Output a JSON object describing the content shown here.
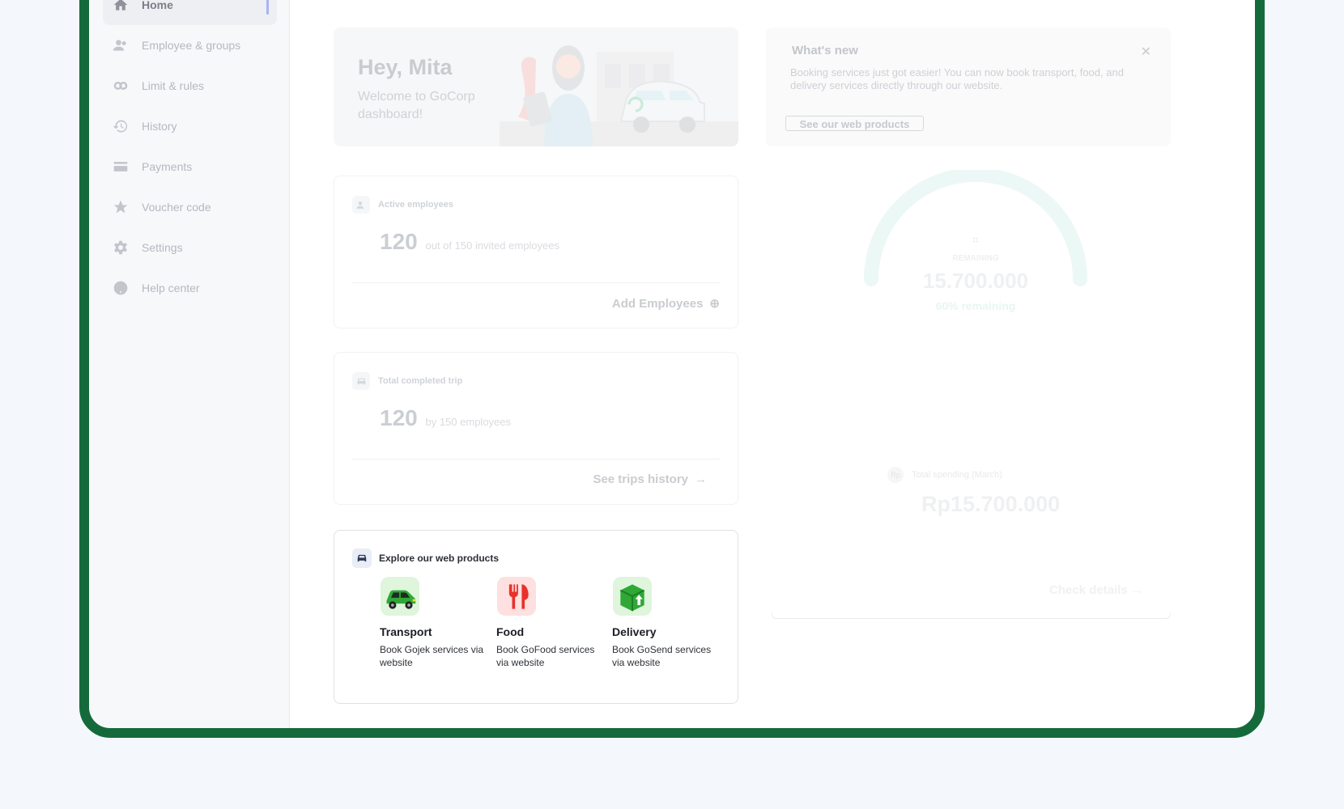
{
  "sidebar": {
    "items": [
      {
        "label": "Home",
        "icon": "home-icon",
        "active": true
      },
      {
        "label": "Employee & groups",
        "icon": "people-icon"
      },
      {
        "label": "Limit & rules",
        "icon": "limit-icon"
      },
      {
        "label": "History",
        "icon": "history-icon"
      },
      {
        "label": "Payments",
        "icon": "card-icon"
      },
      {
        "label": "Voucher code",
        "icon": "star-icon"
      },
      {
        "label": "Settings",
        "icon": "gear-icon"
      },
      {
        "label": "Help center",
        "icon": "help-icon"
      }
    ]
  },
  "greeting": {
    "title": "Hey, Mita",
    "subtitle": "Welcome to GoCorp dashboard!"
  },
  "whats_new": {
    "title": "What's new",
    "description": "Booking services just got easier! You can now book transport, food, and delivery services directly through our website.",
    "button": "See our web products"
  },
  "active_employees": {
    "label": "Active employees",
    "count": "120",
    "detail": "out of 150 invited employees",
    "action": "Add Employees"
  },
  "completed_trips": {
    "label": "Total completed trip",
    "count": "120",
    "detail": "by 150 employees",
    "action": "See trips history"
  },
  "budget": {
    "caption": "REMAINING",
    "amount": "15.700.000",
    "percent": "60% remaining",
    "remaining_fraction": 0.6
  },
  "spending": {
    "badge": "Rp",
    "label": "Total spending (March)",
    "amount": "Rp15.700.000",
    "action": "Check details"
  },
  "explore": {
    "title": "Explore our web products",
    "products": [
      {
        "name": "Transport",
        "description": "Book Gojek services via website",
        "icon": "car-icon",
        "color": "#dff5dc"
      },
      {
        "name": "Food",
        "description": "Book GoFood services via website",
        "icon": "food-icon",
        "color": "#fde0df"
      },
      {
        "name": "Delivery",
        "description": "Book GoSend services via website",
        "icon": "package-icon",
        "color": "#dff5dc"
      }
    ]
  },
  "colors": {
    "frame": "#156a3b",
    "accent": "#a7b4f2",
    "gauge": "#e3f6f1"
  }
}
